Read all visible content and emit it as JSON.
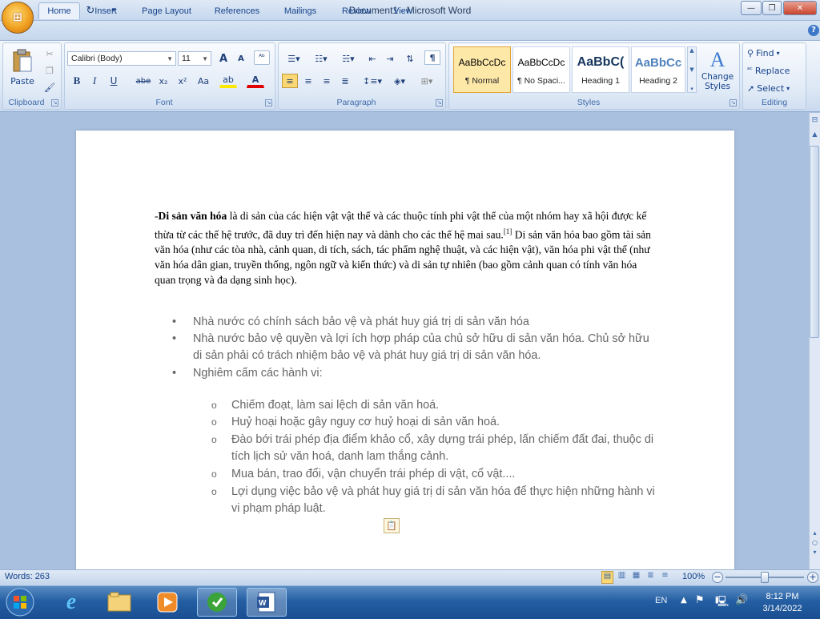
{
  "app": {
    "title": "Document1 - Microsoft Word",
    "office_button_glyph": "⊞"
  },
  "quick_access": {
    "save_icon": "💾",
    "undo_icon": "↶",
    "redo_icon": "↻",
    "dropdown": "▾"
  },
  "window": {
    "minimize": "—",
    "restore": "❐",
    "close": "✕",
    "help": "?"
  },
  "tabs": [
    "Home",
    "Insert",
    "Page Layout",
    "References",
    "Mailings",
    "Review",
    "View"
  ],
  "active_tab": "Home",
  "ribbon": {
    "clipboard": {
      "label": "Clipboard",
      "paste": "Paste"
    },
    "font": {
      "label": "Font",
      "font_name": "Calibri (Body)",
      "font_size": "11",
      "grow": "A",
      "shrink": "A",
      "clear": "ᴬᵇ",
      "bold": "B",
      "italic": "I",
      "underline": "U",
      "strike": "abe",
      "subscript": "x₂",
      "superscript": "x²",
      "change_case": "Aa",
      "highlight": "ab",
      "font_color": "A"
    },
    "paragraph": {
      "label": "Paragraph",
      "show_marks": "¶"
    },
    "styles": {
      "label": "Styles",
      "items": [
        {
          "sample": "AaBbCcDc",
          "name": "¶ Normal"
        },
        {
          "sample": "AaBbCcDc",
          "name": "¶ No Spaci..."
        },
        {
          "sample": "AaBbC(",
          "name": "Heading 1"
        },
        {
          "sample": "AaBbCc",
          "name": "Heading 2"
        }
      ],
      "change_styles": "Change Styles"
    },
    "editing": {
      "label": "Editing",
      "find": "Find",
      "replace": "Replace",
      "select": "Select"
    }
  },
  "document": {
    "paragraph_prefix": "-",
    "paragraph_bold": "Di sản văn hóa",
    "paragraph_part1": " là di sản của các hiện vật vật thể và các thuộc tính phi vật thể của một nhóm hay xã hội được kế thừa từ các thế hệ trước, đã duy trì đến hiện nay và dành cho các thế hệ mai sau.",
    "footnote": "[1]",
    "paragraph_part2": " Di sản văn hóa bao gồm tài sản văn hóa (như các tòa nhà, cảnh quan, di tích, sách, tác phẩm nghệ thuật, và các hiện vật), văn hóa phi vật thể (như văn hóa dân gian, truyền thống, ngôn ngữ và kiến thức) và di sản tự nhiên (bao gồm cảnh quan có tính văn hóa quan trọng và đa dạng sinh học).",
    "bullets": [
      "Nhà nước có chính sách bảo vệ và phát huy giá trị di sản văn hóa",
      "Nhà nước bảo vệ quyền và lợi ích hợp pháp của chủ sở hữu di sản văn hóa. Chủ sở hữu di sản phải có trách nhiệm bảo vệ và phát huy giá trị di sản văn hóa.",
      "Nghiêm cấm các hành vi:"
    ],
    "sub_bullets": [
      "Chiếm đoạt, làm sai lệch di sản văn hoá.",
      "Huỷ hoại hoặc gây nguy cơ huỷ hoại di sản văn hoá.",
      "Đào bới trái phép địa điểm khảo cổ, xây dựng trái phép, lấn chiếm đất đai, thuộc di tích lịch sử văn hoá, danh lam thắng cảnh.",
      "Mua bán, trao đổi, vận chuyển trái phép di vật, cổ vật....",
      "Lợi dụng việc bảo vệ và phát huy giá trị di sản văn hóa để thực hiện những hành vi vi phạm pháp luật."
    ],
    "bullet_glyph": "•",
    "sub_bullet_glyph": "o"
  },
  "status": {
    "words": "Words: 263",
    "zoom": "100%",
    "zoom_minus": "−",
    "zoom_plus": "+"
  },
  "taskbar": {
    "language": "EN",
    "time": "8:12 PM",
    "date": "3/14/2022"
  }
}
